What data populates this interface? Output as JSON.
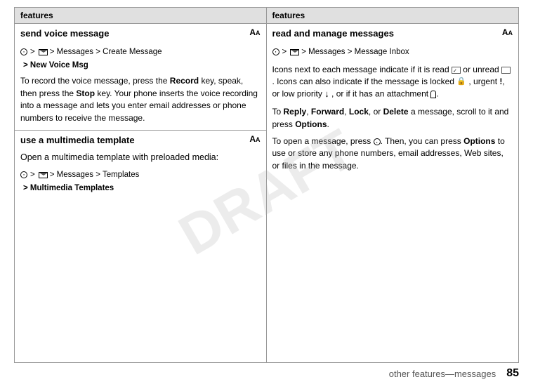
{
  "page": {
    "watermark": "DRAFT",
    "bottom_label": "other features—messages",
    "page_number": "85"
  },
  "left_col": {
    "features_label": "features",
    "section1": {
      "title": "send voice message",
      "nav1": "> Messages > Create Message",
      "nav2": "> New Voice Msg",
      "body": "To record the voice message, press the Record key, speak, then press the Stop key. Your phone inserts the voice recording into a message and lets you enter email addresses or phone numbers to receive the message."
    },
    "section2": {
      "title": "use a multimedia template",
      "body_intro": "Open a multimedia template with preloaded media:",
      "nav1": "> Messages > Templates",
      "nav2": "> Multimedia Templates"
    }
  },
  "right_col": {
    "features_label": "features",
    "section1": {
      "title": "read and manage messages",
      "nav1": "> Messages > Message Inbox",
      "para1": "Icons next to each message indicate if it is read or unread . Icons can also indicate if the message is locked , urgent !, or low priority ↓, or if it has an attachment .",
      "para2_prefix": "To ",
      "para2_actions": "Reply, Forward, Lock,",
      "para2_or": " or ",
      "para2_action2": "Delete",
      "para2_suffix": " a message, scroll to it and press Options.",
      "para3_prefix": "To open a message, press",
      "para3_suffix": ". Then, you can press Options to use or store any phone numbers, email addresses, Web sites, or files in the message."
    }
  }
}
